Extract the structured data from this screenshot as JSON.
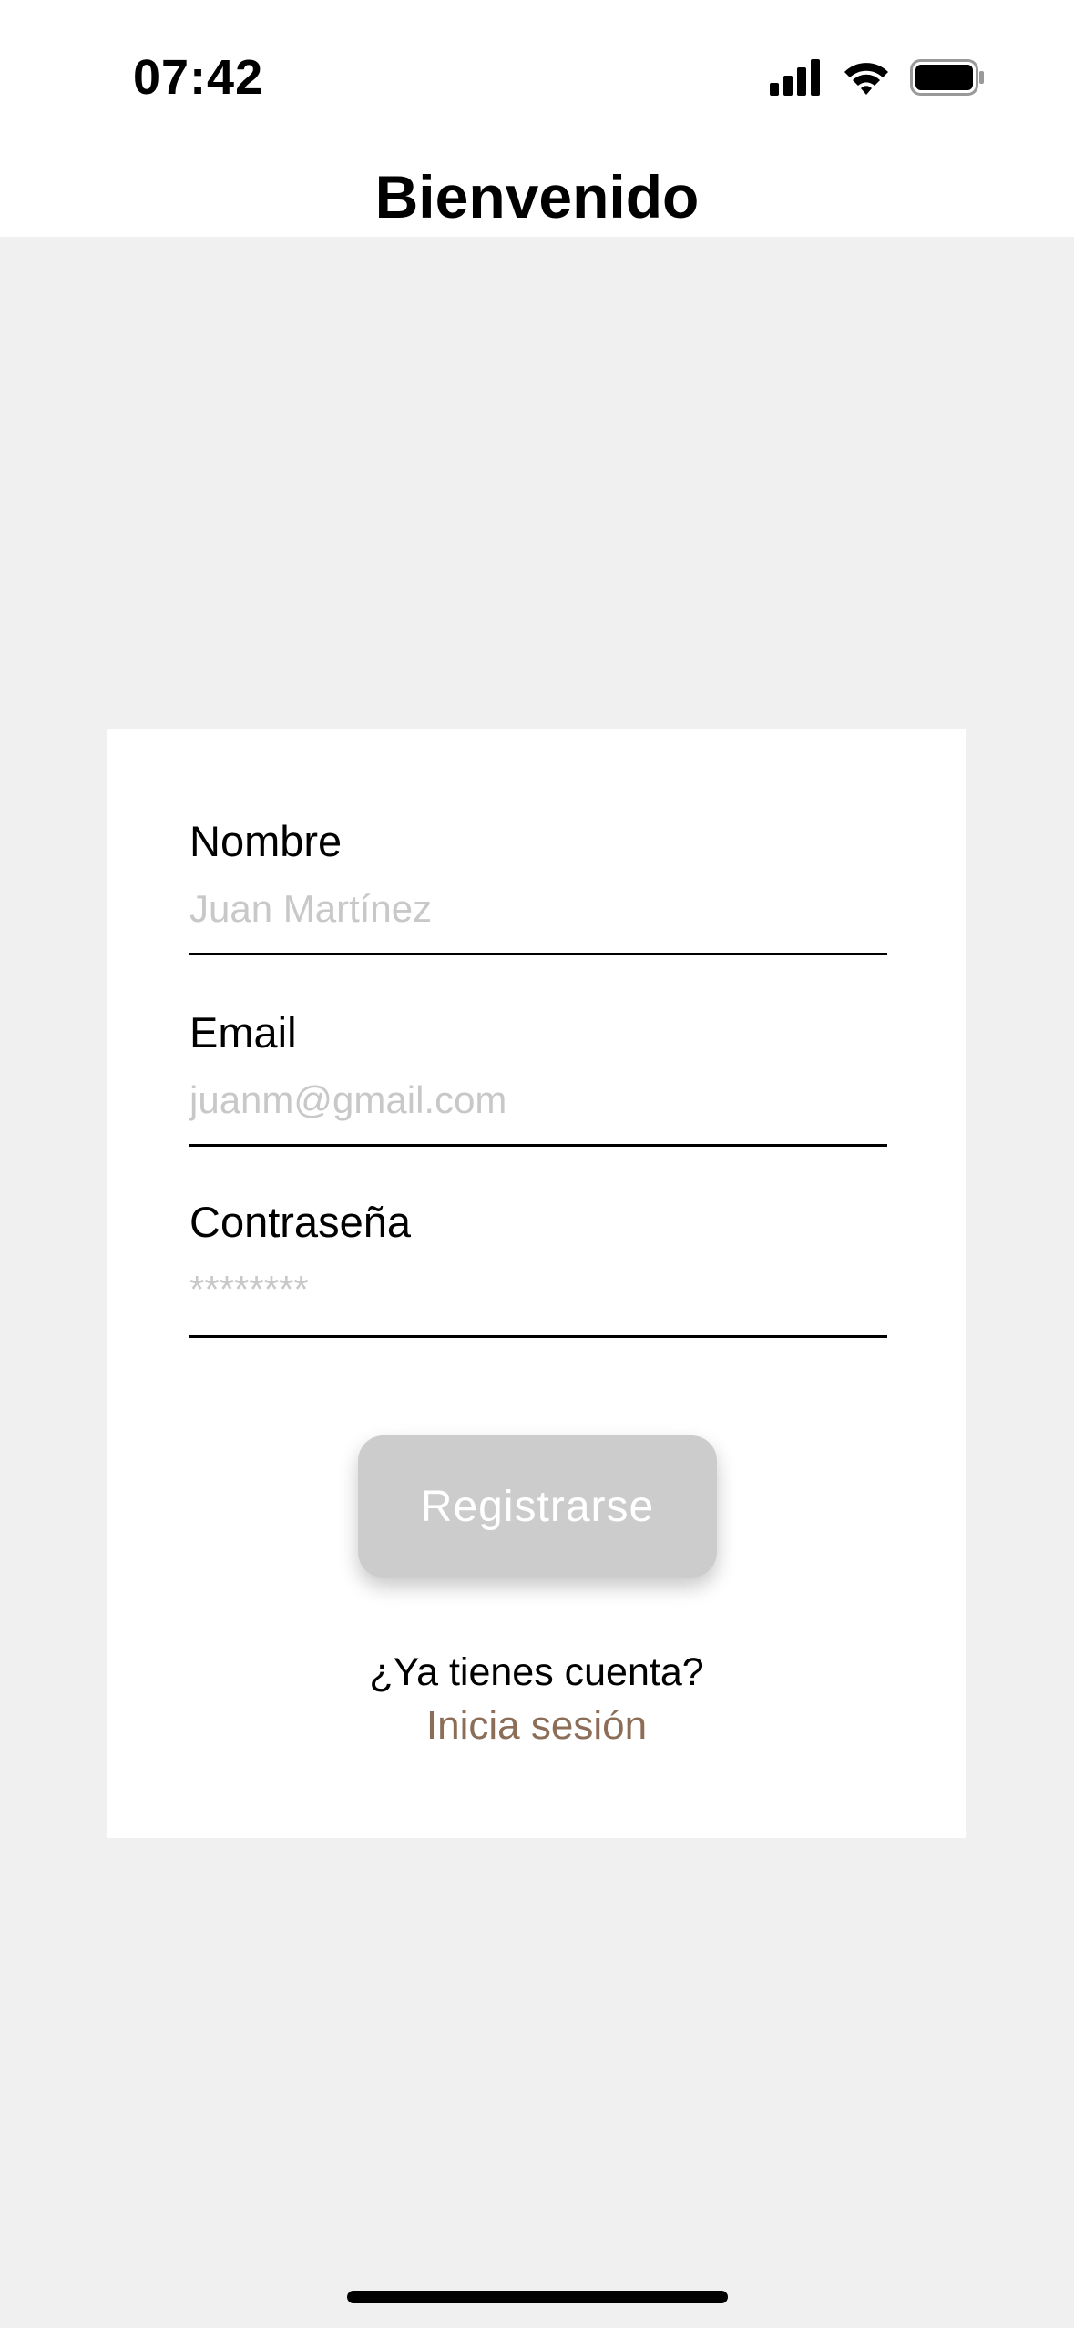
{
  "status_bar": {
    "time": "07:42",
    "icons": [
      "cellular-signal-icon",
      "wifi-icon",
      "battery-icon"
    ]
  },
  "nav": {
    "title": "Bienvenido"
  },
  "form": {
    "name": {
      "label": "Nombre",
      "placeholder": "Juan Martínez",
      "value": ""
    },
    "email": {
      "label": "Email",
      "placeholder": "juanm@gmail.com",
      "value": ""
    },
    "password": {
      "label": "Contraseña",
      "placeholder": "********",
      "value": ""
    },
    "submit_label": "Registrarse",
    "login_prompt": "¿Ya tienes cuenta?",
    "login_link": "Inicia sesión"
  },
  "colors": {
    "background": "#f0f0f0",
    "card": "#ffffff",
    "button_disabled": "#cccccc",
    "link": "#8c6e58",
    "placeholder": "#c8c8c8"
  }
}
